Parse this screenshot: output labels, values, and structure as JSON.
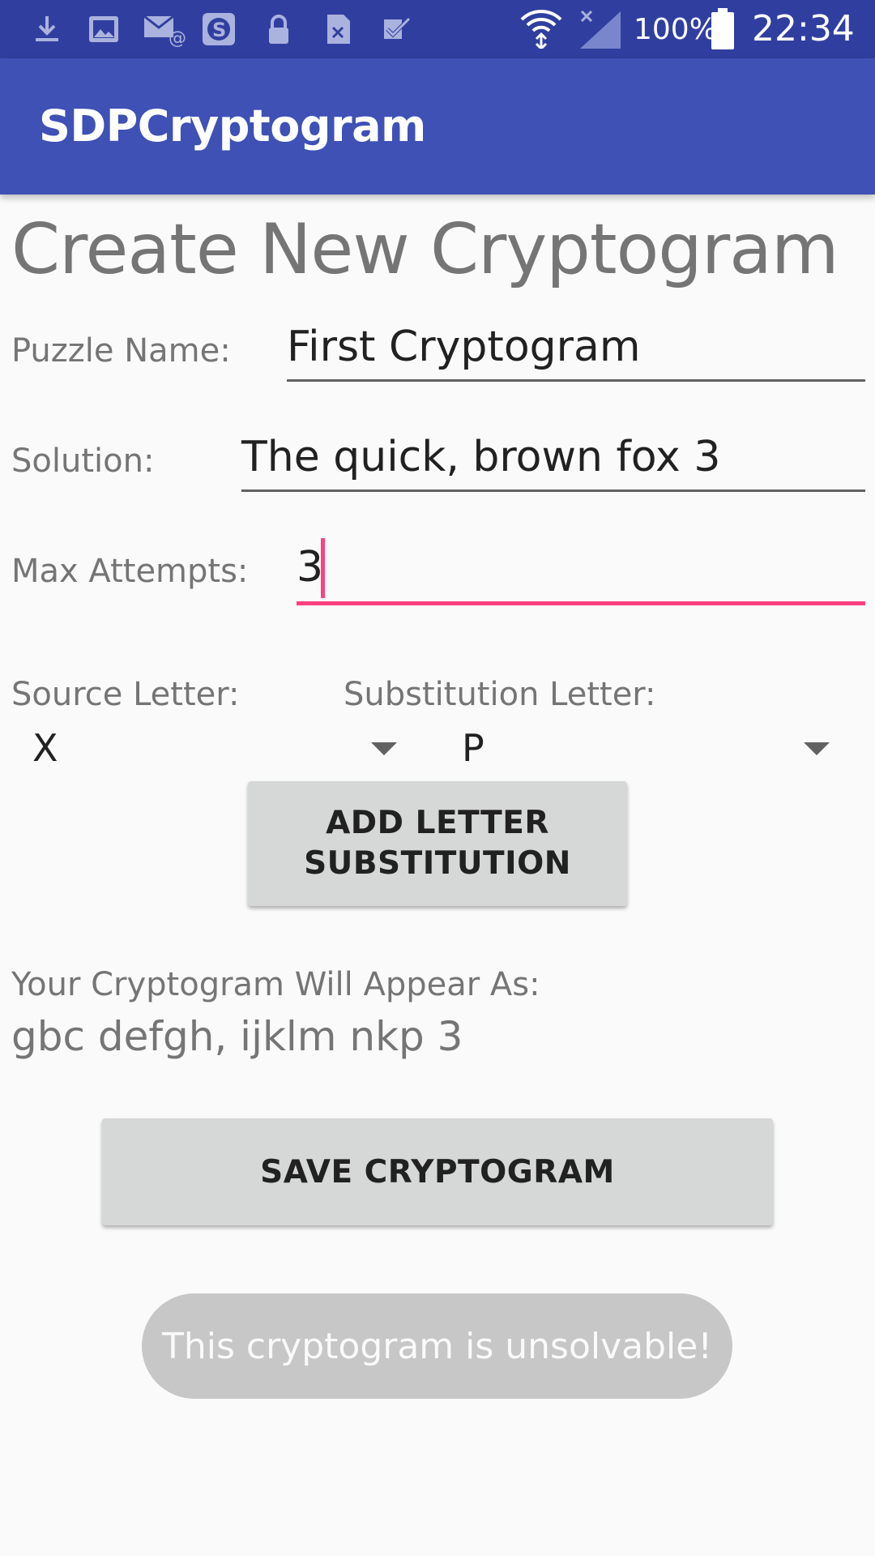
{
  "status_bar": {
    "battery": "100%",
    "time": "22:34",
    "icons": [
      "download-icon",
      "image-icon",
      "email-icon",
      "dollar-app-icon",
      "lock-icon",
      "file-x-icon",
      "checkbox-icon",
      "wifi-icon",
      "no-signal-icon",
      "battery-icon"
    ]
  },
  "app_bar": {
    "title": "SDPCryptogram"
  },
  "page": {
    "title": "Create New Cryptogram"
  },
  "form": {
    "puzzle_name": {
      "label": "Puzzle Name:",
      "value": "First Cryptogram"
    },
    "solution": {
      "label": "Solution:",
      "value": "The quick, brown fox 3"
    },
    "max_attempts": {
      "label": "Max Attempts:",
      "value": "3"
    }
  },
  "substitution": {
    "source_label": "Source Letter:",
    "source_value": "X",
    "target_label": "Substitution Letter:",
    "target_value": "P",
    "add_button": "ADD LETTER SUBSTITUTION"
  },
  "preview": {
    "label": "Your Cryptogram Will Appear As:",
    "value": "gbc defgh, ijklm nkp 3"
  },
  "save_button": "SAVE CRYPTOGRAM",
  "toast": "This cryptogram is unsolvable!",
  "colors": {
    "primary": "#3f51b5",
    "primary_dark": "#303f9f",
    "accent": "#ff4081"
  }
}
